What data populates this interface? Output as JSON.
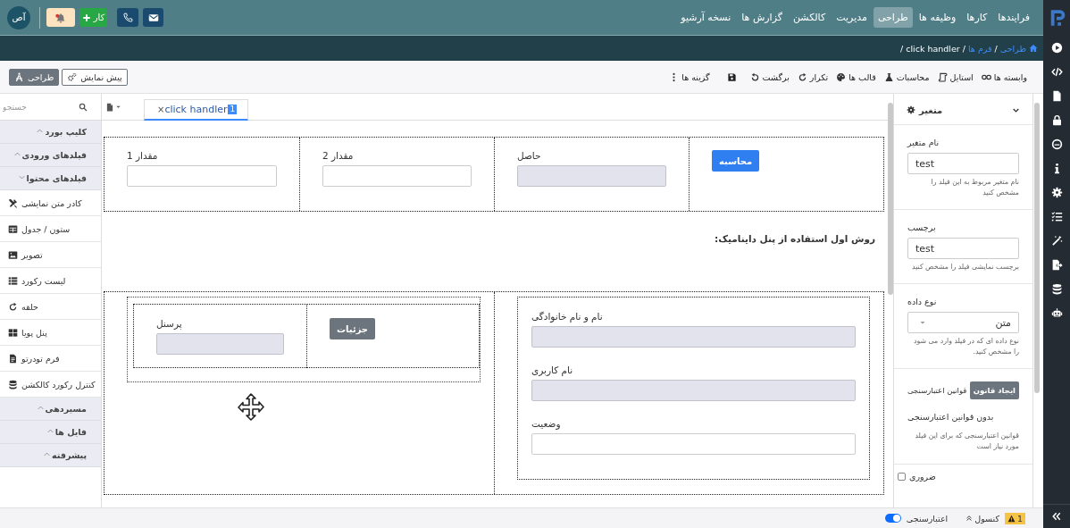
{
  "nav": {
    "avatar": "آص",
    "add_task": "کار",
    "menu": [
      {
        "label": "فرایندها",
        "selected": false
      },
      {
        "label": "کارها",
        "selected": false
      },
      {
        "label": "وظیفه ها",
        "selected": false
      },
      {
        "label": "طراحی",
        "selected": true
      },
      {
        "label": "مدیریت",
        "selected": false
      },
      {
        "label": "کالکشن",
        "selected": false
      },
      {
        "label": "گزارش ها",
        "selected": false
      },
      {
        "label": "نسخه آرشیو",
        "selected": false
      }
    ]
  },
  "breadcrumb": {
    "separator": "/",
    "items": [
      {
        "label": "طراحی",
        "link": true
      },
      {
        "label": "فرم ها",
        "link": true
      },
      {
        "label": "click handler",
        "link": false
      }
    ]
  },
  "toolbar": {
    "actions": [
      {
        "label": "وابسته ها"
      },
      {
        "label": "استایل"
      },
      {
        "label": "محاسبات"
      },
      {
        "label": "قالب ها"
      },
      {
        "label": "تکرار"
      },
      {
        "label": "برگشت"
      }
    ],
    "options": "گزینه ها",
    "modes": [
      {
        "label": "پیش نمایش",
        "selected": false
      },
      {
        "label": "طراحی",
        "selected": true
      }
    ]
  },
  "palette": {
    "search": {
      "placeholder": "جستجو"
    },
    "sections": [
      {
        "label": "کلیپ بورد",
        "expanded": false
      },
      {
        "label": "فیلدهای ورودی",
        "expanded": false
      },
      {
        "label": "فیلدهای محتوا",
        "expanded": true,
        "children": [
          {
            "label": "کادر متن نمایشی"
          },
          {
            "label": "ستون / جدول"
          },
          {
            "label": "تصویر"
          },
          {
            "label": "لیست رکورد"
          },
          {
            "label": "حلقه"
          },
          {
            "label": "پنل پویا"
          },
          {
            "label": "فرم تودرتو"
          },
          {
            "label": "کنترل رکورد کالکشن"
          }
        ]
      },
      {
        "label": "مسیردهی",
        "expanded": false
      },
      {
        "label": "فایل ها",
        "expanded": false
      },
      {
        "label": "پیشرفته",
        "expanded": false
      }
    ]
  },
  "editor": {
    "tabs": [
      {
        "label": "click handler",
        "close": "×",
        "badge": "1",
        "selected": true
      }
    ],
    "row_1": [
      {
        "kind": "primary",
        "label": "محاسبه"
      },
      {
        "kind": "field",
        "label": "حاصل",
        "readonly": true
      },
      {
        "kind": "field",
        "label": "مقدار 2",
        "readonly": false
      },
      {
        "kind": "field",
        "label": "مقدار 1",
        "readonly": false
      }
    ],
    "heading": "روش اول استفاده از پنل داینامیک:",
    "form_fields": [
      {
        "label": "نام و نام خانوادگی",
        "readonly": true
      },
      {
        "label": "نام کاربری",
        "readonly": true
      },
      {
        "label": "وضعیت",
        "readonly": false
      }
    ],
    "dynamic_panel": [
      {
        "kind": "secondary",
        "label": "جزئیات"
      },
      {
        "kind": "field",
        "label": "پرسنل",
        "readonly": true
      }
    ]
  },
  "properties": {
    "title": "متغیر",
    "fields": [
      {
        "kind": "input",
        "label": "نام متغیر",
        "value": "test",
        "hint": "نام متغیر مربوط به این فیلد را مشخص کنید"
      },
      {
        "kind": "input",
        "label": "برچسب",
        "value": "test",
        "hint": "برچسب نمایشی فیلد را مشخص کنید"
      },
      {
        "kind": "select",
        "label": "نوع داده",
        "value": "متن",
        "hint": "نوع داده ای که در فیلد وارد می شود را مشخص کنید."
      }
    ],
    "validation": {
      "label": "قوانین اعتبارسنجی",
      "button": "ایجاد قانون",
      "empty": "بدون قوانین اعتبارسنجی",
      "hint": "قوانین اعتبارسنجی که برای این فیلد مورد نیاز است"
    },
    "required": {
      "label": "ضروری",
      "checked": false
    }
  },
  "status": {
    "warnings": "1",
    "console": "کنسول",
    "validation": {
      "label": "اعتبارسنجی",
      "on": true
    }
  }
}
